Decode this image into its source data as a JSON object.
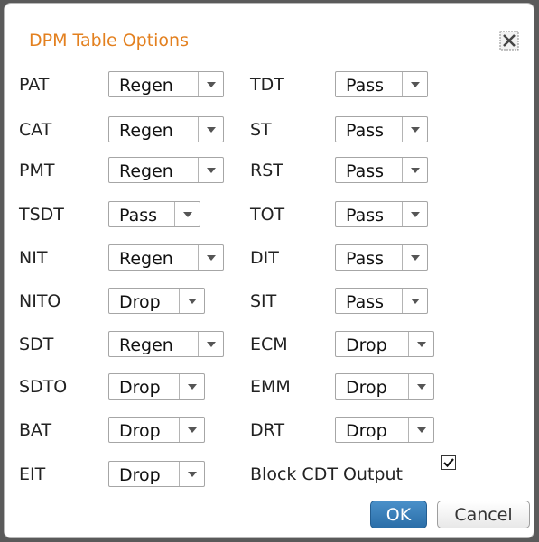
{
  "dialog": {
    "title": "DPM Table Options",
    "close_icon": "close-icon"
  },
  "left_column": [
    {
      "label": "PAT",
      "value": "Regen"
    },
    {
      "label": "CAT",
      "value": "Regen"
    },
    {
      "label": "PMT",
      "value": "Regen"
    },
    {
      "label": "TSDT",
      "value": "Pass"
    },
    {
      "label": "NIT",
      "value": "Regen"
    },
    {
      "label": "NITO",
      "value": "Drop"
    },
    {
      "label": "SDT",
      "value": "Regen"
    },
    {
      "label": "SDTO",
      "value": "Drop"
    },
    {
      "label": "BAT",
      "value": "Drop"
    },
    {
      "label": "EIT",
      "value": "Drop"
    }
  ],
  "right_column": [
    {
      "label": "TDT",
      "value": "Pass"
    },
    {
      "label": "ST",
      "value": "Pass"
    },
    {
      "label": "RST",
      "value": "Pass"
    },
    {
      "label": "TOT",
      "value": "Pass"
    },
    {
      "label": "DIT",
      "value": "Pass"
    },
    {
      "label": "SIT",
      "value": "Pass"
    },
    {
      "label": "ECM",
      "value": "Drop"
    },
    {
      "label": "EMM",
      "value": "Drop"
    },
    {
      "label": "DRT",
      "value": "Drop"
    }
  ],
  "block_cdt": {
    "label": "Block CDT Output",
    "checked": true
  },
  "buttons": {
    "ok_label": "OK",
    "cancel_label": "Cancel"
  },
  "colors": {
    "title": "#e3801f",
    "ok_button": "#2a6ea8"
  }
}
